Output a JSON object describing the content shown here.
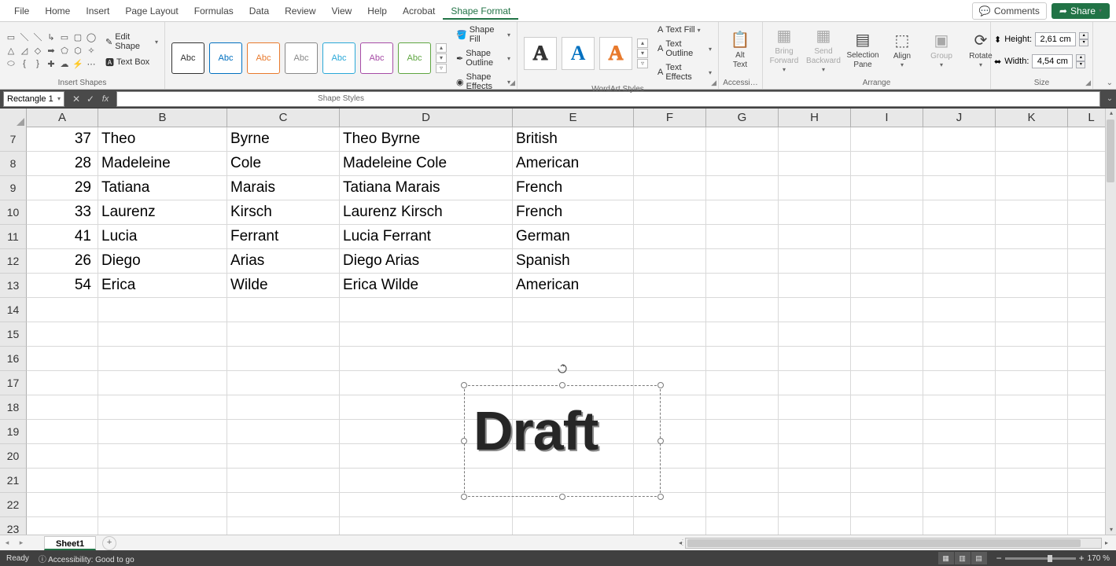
{
  "menu": {
    "items": [
      "File",
      "Home",
      "Insert",
      "Page Layout",
      "Formulas",
      "Data",
      "Review",
      "View",
      "Help",
      "Acrobat",
      "Shape Format"
    ],
    "active_index": 10,
    "comments": "Comments",
    "share": "Share"
  },
  "ribbon": {
    "insert_shapes": {
      "label": "Insert Shapes",
      "edit_shape": "Edit Shape",
      "text_box": "Text Box"
    },
    "shape_styles": {
      "label": "Shape Styles",
      "swatch_text": "Abc",
      "shape_fill": "Shape Fill",
      "shape_outline": "Shape Outline",
      "shape_effects": "Shape Effects"
    },
    "wordart": {
      "label": "WordArt Styles",
      "swatch_text": "A",
      "text_fill": "Text Fill",
      "text_outline": "Text Outline",
      "text_effects": "Text Effects"
    },
    "accessibility": {
      "label": "Accessi…",
      "alt_text": "Alt\nText"
    },
    "arrange": {
      "label": "Arrange",
      "bring_forward": "Bring\nForward",
      "send_backward": "Send\nBackward",
      "selection_pane": "Selection\nPane",
      "align": "Align",
      "group": "Group",
      "rotate": "Rotate"
    },
    "size": {
      "label": "Size",
      "height_label": "Height:",
      "width_label": "Width:",
      "height_value": "2,61 cm",
      "width_value": "4,54 cm"
    }
  },
  "formula_bar": {
    "namebox": "Rectangle 1",
    "value": ""
  },
  "columns": [
    "A",
    "B",
    "C",
    "D",
    "E",
    "F",
    "G",
    "H",
    "I",
    "J",
    "K",
    "L"
  ],
  "row_headers": [
    7,
    8,
    9,
    10,
    11,
    12,
    13,
    14,
    15,
    16,
    17,
    18,
    19,
    20,
    21,
    22,
    23
  ],
  "table": [
    {
      "a": 37,
      "b": "Theo",
      "c": "Byrne",
      "d": "Theo Byrne",
      "e": "British"
    },
    {
      "a": 28,
      "b": "Madeleine",
      "c": "Cole",
      "d": "Madeleine Cole",
      "e": "American"
    },
    {
      "a": 29,
      "b": "Tatiana",
      "c": "Marais",
      "d": "Tatiana Marais",
      "e": "French"
    },
    {
      "a": 33,
      "b": "Laurenz",
      "c": "Kirsch",
      "d": "Laurenz Kirsch",
      "e": "French"
    },
    {
      "a": 41,
      "b": "Lucia",
      "c": "Ferrant",
      "d": "Lucia Ferrant",
      "e": "German"
    },
    {
      "a": 26,
      "b": "Diego",
      "c": "Arias",
      "d": "Diego Arias",
      "e": "Spanish"
    },
    {
      "a": 54,
      "b": "Erica",
      "c": "Wilde",
      "d": "Erica Wilde",
      "e": "American"
    }
  ],
  "shape": {
    "text": "Draft"
  },
  "tabs": {
    "sheet1": "Sheet1"
  },
  "status": {
    "ready": "Ready",
    "accessibility": "Accessibility: Good to go",
    "zoom": "170 %"
  }
}
